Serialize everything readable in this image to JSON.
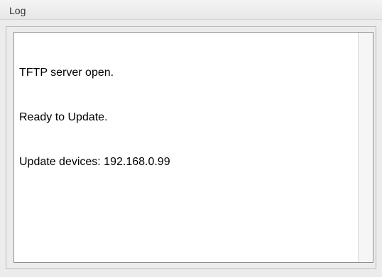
{
  "header": {
    "title": "Log"
  },
  "log": {
    "lines": [
      "TFTP server open.",
      "Ready to Update.",
      "Update devices: 192.168.0.99"
    ]
  }
}
